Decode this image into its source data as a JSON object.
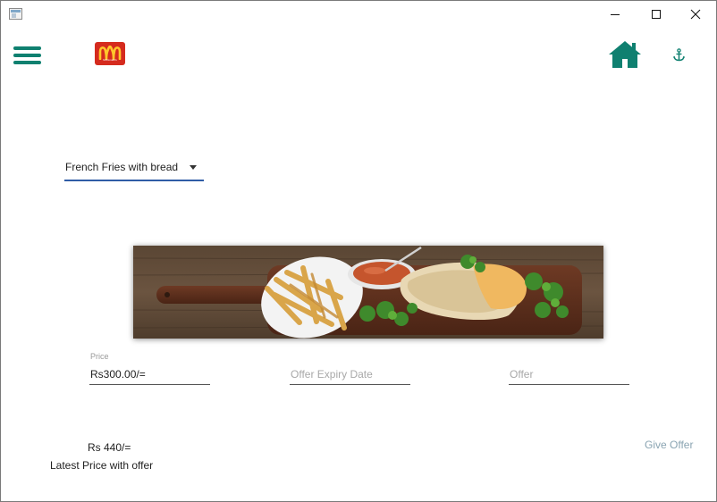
{
  "window": {
    "controls": [
      "minimize",
      "maximize",
      "close"
    ]
  },
  "header": {
    "logo_text": "McDonald's",
    "brand_color": "#d52b1e",
    "accent_color": "#0f8070",
    "icons": [
      "menu-icon",
      "home-icon",
      "anchor-icon"
    ]
  },
  "dropdown": {
    "selected": "French Fries with bread"
  },
  "form": {
    "price_label": "Price",
    "price_value": "Rs300.00/=",
    "expiry_placeholder": "Offer Expiry Date",
    "offer_placeholder": "Offer"
  },
  "footer": {
    "latest_price": "Rs 440/=",
    "latest_label": "Latest Price with offer",
    "give_offer_label": "Give Offer"
  }
}
